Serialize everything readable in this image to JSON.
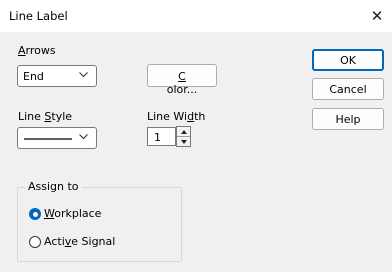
{
  "window": {
    "title": "Line Label",
    "close_glyph": "✕"
  },
  "arrows": {
    "label_prefix": "",
    "label_mnemonic": "A",
    "label_rest": "rrows",
    "selected": "End"
  },
  "color_button": {
    "mnemonic": "C",
    "rest": "olor..."
  },
  "line_style": {
    "label_pre": "Line ",
    "label_mnemonic": "S",
    "label_post": "tyle"
  },
  "line_width": {
    "label_pre": "Line Wi",
    "label_mnemonic": "d",
    "label_post": "th",
    "value": "1"
  },
  "buttons": {
    "ok": "OK",
    "cancel": "Cancel",
    "help": "Help"
  },
  "assign_to": {
    "label": "Assign to",
    "workplace": {
      "mnemonic": "W",
      "rest": "orkplace",
      "selected": true
    },
    "active_signal": {
      "pre": "Acti",
      "mnemonic": "v",
      "post": "e Signal",
      "selected": false
    }
  },
  "colors": {
    "accent": "#0067c0",
    "dialog_bg": "#f0f0f0"
  },
  "icons": {
    "close": "close-icon",
    "dropdown": "chevron-down-icon",
    "spin_up": "spin-up-icon",
    "spin_down": "spin-down-icon"
  }
}
